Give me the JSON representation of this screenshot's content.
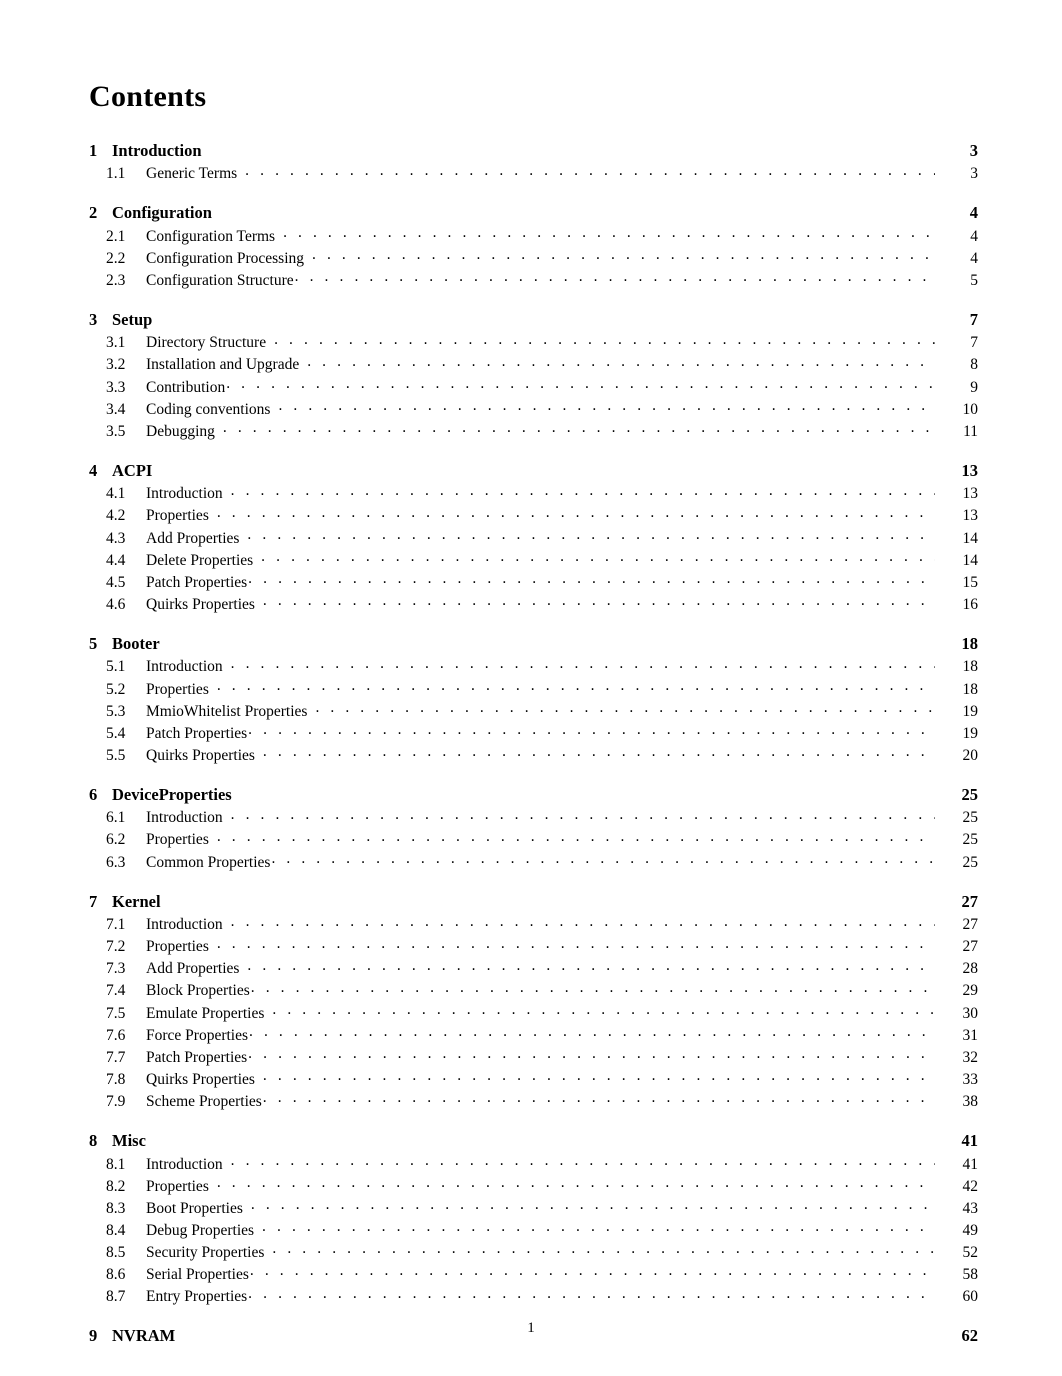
{
  "document": {
    "heading": "Contents",
    "folio": "1"
  },
  "toc": {
    "chapters": [
      {
        "number": "1",
        "title": "Introduction",
        "page": "3",
        "sections": [
          {
            "number": "1.1",
            "title": "Generic Terms",
            "page": "3",
            "gap": true
          }
        ]
      },
      {
        "number": "2",
        "title": "Configuration",
        "page": "4",
        "sections": [
          {
            "number": "2.1",
            "title": "Configuration Terms",
            "page": "4",
            "gap": true
          },
          {
            "number": "2.2",
            "title": "Configuration Processing",
            "page": "4",
            "gap": true
          },
          {
            "number": "2.3",
            "title": "Configuration Structure",
            "page": "5",
            "gap": false
          }
        ]
      },
      {
        "number": "3",
        "title": "Setup",
        "page": "7",
        "sections": [
          {
            "number": "3.1",
            "title": "Directory Structure",
            "page": "7",
            "gap": true
          },
          {
            "number": "3.2",
            "title": "Installation and Upgrade",
            "page": "8",
            "gap": true
          },
          {
            "number": "3.3",
            "title": "Contribution",
            "page": "9",
            "gap": false
          },
          {
            "number": "3.4",
            "title": "Coding conventions",
            "page": "10",
            "gap": true
          },
          {
            "number": "3.5",
            "title": "Debugging",
            "page": "11",
            "gap": true
          }
        ]
      },
      {
        "number": "4",
        "title": "ACPI",
        "page": "13",
        "sections": [
          {
            "number": "4.1",
            "title": "Introduction",
            "page": "13",
            "gap": true
          },
          {
            "number": "4.2",
            "title": "Properties",
            "page": "13",
            "gap": true
          },
          {
            "number": "4.3",
            "title": "Add Properties",
            "page": "14",
            "gap": true
          },
          {
            "number": "4.4",
            "title": "Delete Properties",
            "page": "14",
            "gap": true
          },
          {
            "number": "4.5",
            "title": "Patch Properties",
            "page": "15",
            "gap": false
          },
          {
            "number": "4.6",
            "title": "Quirks Properties",
            "page": "16",
            "gap": true
          }
        ]
      },
      {
        "number": "5",
        "title": "Booter",
        "page": "18",
        "sections": [
          {
            "number": "5.1",
            "title": "Introduction",
            "page": "18",
            "gap": true
          },
          {
            "number": "5.2",
            "title": "Properties",
            "page": "18",
            "gap": true
          },
          {
            "number": "5.3",
            "title": "MmioWhitelist Properties",
            "page": "19",
            "gap": true
          },
          {
            "number": "5.4",
            "title": "Patch Properties",
            "page": "19",
            "gap": false
          },
          {
            "number": "5.5",
            "title": "Quirks Properties",
            "page": "20",
            "gap": true
          }
        ]
      },
      {
        "number": "6",
        "title": "DeviceProperties",
        "page": "25",
        "sections": [
          {
            "number": "6.1",
            "title": "Introduction",
            "page": "25",
            "gap": true
          },
          {
            "number": "6.2",
            "title": "Properties",
            "page": "25",
            "gap": true
          },
          {
            "number": "6.3",
            "title": "Common Properties",
            "page": "25",
            "gap": false
          }
        ]
      },
      {
        "number": "7",
        "title": "Kernel",
        "page": "27",
        "sections": [
          {
            "number": "7.1",
            "title": "Introduction",
            "page": "27",
            "gap": true
          },
          {
            "number": "7.2",
            "title": "Properties",
            "page": "27",
            "gap": true
          },
          {
            "number": "7.3",
            "title": "Add Properties",
            "page": "28",
            "gap": true
          },
          {
            "number": "7.4",
            "title": "Block Properties",
            "page": "29",
            "gap": false
          },
          {
            "number": "7.5",
            "title": "Emulate Properties",
            "page": "30",
            "gap": true
          },
          {
            "number": "7.6",
            "title": "Force Properties",
            "page": "31",
            "gap": false
          },
          {
            "number": "7.7",
            "title": "Patch Properties",
            "page": "32",
            "gap": false
          },
          {
            "number": "7.8",
            "title": "Quirks Properties",
            "page": "33",
            "gap": true
          },
          {
            "number": "7.9",
            "title": "Scheme Properties",
            "page": "38",
            "gap": false
          }
        ]
      },
      {
        "number": "8",
        "title": "Misc",
        "page": "41",
        "sections": [
          {
            "number": "8.1",
            "title": "Introduction",
            "page": "41",
            "gap": true
          },
          {
            "number": "8.2",
            "title": "Properties",
            "page": "42",
            "gap": true
          },
          {
            "number": "8.3",
            "title": "Boot Properties",
            "page": "43",
            "gap": true
          },
          {
            "number": "8.4",
            "title": "Debug Properties",
            "page": "49",
            "gap": true
          },
          {
            "number": "8.5",
            "title": "Security Properties",
            "page": "52",
            "gap": true
          },
          {
            "number": "8.6",
            "title": "Serial Properties",
            "page": "58",
            "gap": false
          },
          {
            "number": "8.7",
            "title": "Entry Properties",
            "page": "60",
            "gap": false
          }
        ]
      },
      {
        "number": "9",
        "title": "NVRAM",
        "page": "62",
        "sections": []
      }
    ]
  }
}
